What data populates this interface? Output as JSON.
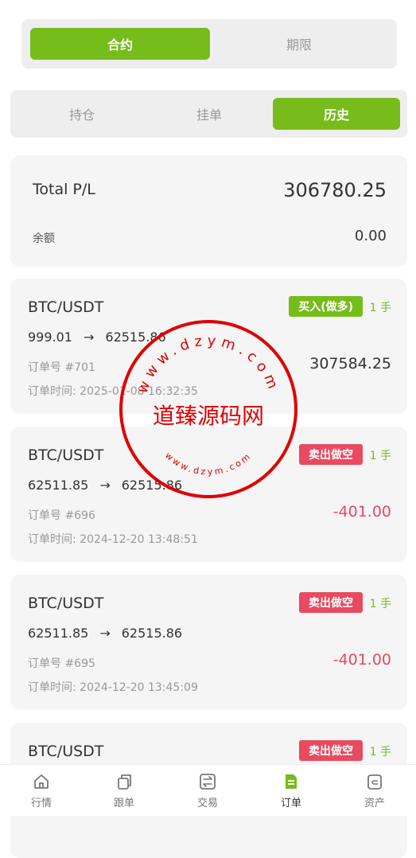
{
  "top_tabs": [
    "合约",
    "期限"
  ],
  "sub_tabs": [
    "持仓",
    "挂单",
    "历史"
  ],
  "summary": {
    "total_label": "Total P/L",
    "total_value": "306780.25",
    "balance_label": "余额",
    "balance_value": "0.00"
  },
  "orders": [
    {
      "pair": "BTC/USDT",
      "side": "买入(做多)",
      "side_type": "buy",
      "qty": "1 手",
      "open": "999.01",
      "close": "62515.86",
      "number": "订单号 #701",
      "time": "订单时间: 2025-01-08 16:32:35",
      "pl": "307584.25"
    },
    {
      "pair": "BTC/USDT",
      "side": "卖出做空",
      "side_type": "sell",
      "qty": "1 手",
      "open": "62511.85",
      "close": "62515.86",
      "number": "订单号 #696",
      "time": "订单时间: 2024-12-20 13:48:51",
      "pl": "-401.00"
    },
    {
      "pair": "BTC/USDT",
      "side": "卖出做空",
      "side_type": "sell",
      "qty": "1 手",
      "open": "62511.85",
      "close": "62515.86",
      "number": "订单号 #695",
      "time": "订单时间: 2024-12-20 13:45:09",
      "pl": "-401.00"
    },
    {
      "pair": "BTC/USDT",
      "side": "卖出做空",
      "side_type": "sell",
      "qty": "1 手"
    }
  ],
  "arrow": "→",
  "bottom_nav": [
    {
      "label": "行情",
      "icon": "home-icon"
    },
    {
      "label": "跟单",
      "icon": "copy-icon"
    },
    {
      "label": "交易",
      "icon": "exchange-icon"
    },
    {
      "label": "订单",
      "icon": "order-icon"
    },
    {
      "label": "资产",
      "icon": "wallet-icon"
    }
  ],
  "watermark": {
    "text": "道臻源码网",
    "url_top": "www.dzym.com",
    "url_bottom": "www.dzym.com"
  },
  "colors": {
    "accent": "#76bc1b",
    "sell": "#e84a5f",
    "watermark": "#e00000"
  }
}
